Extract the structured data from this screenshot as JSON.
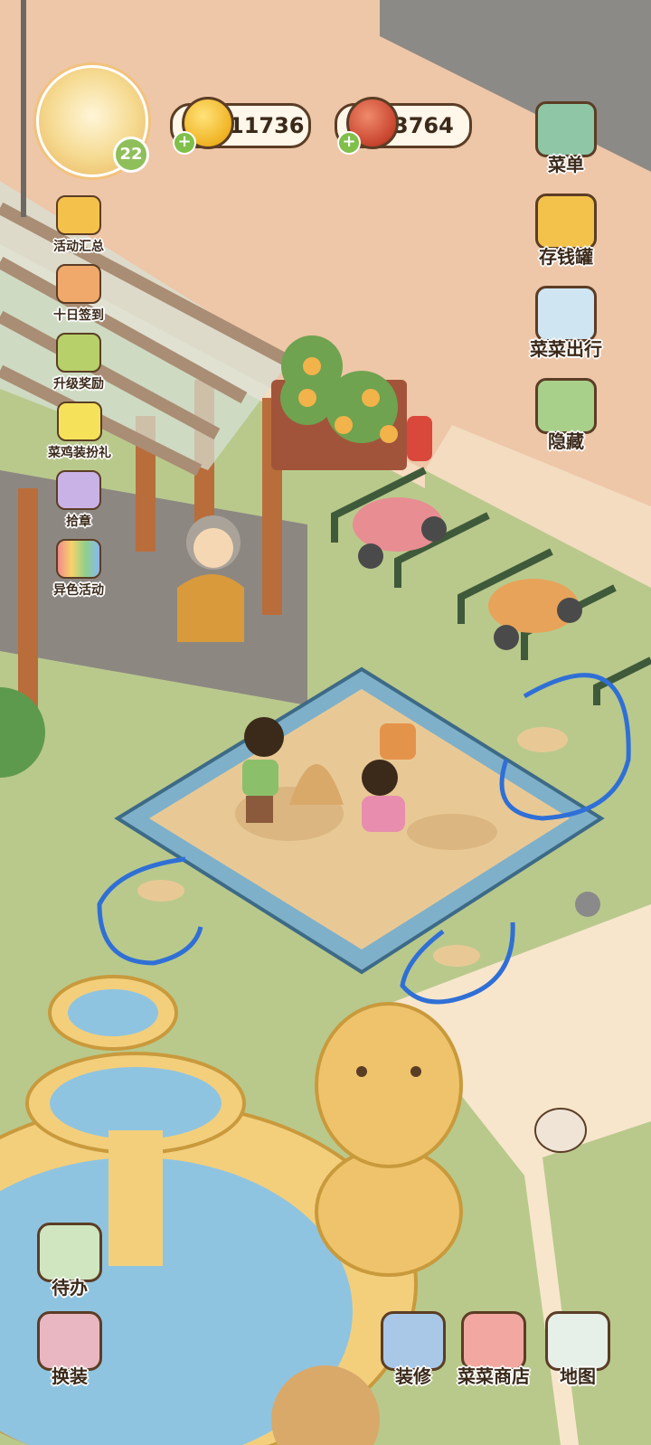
{
  "player": {
    "level": "22"
  },
  "currencies": [
    {
      "name": "coin-icon",
      "amount": "11736"
    },
    {
      "name": "meat-icon",
      "amount": "3764"
    }
  ],
  "left_menu": [
    {
      "label": "活动汇总",
      "icon": "event-summary-icon"
    },
    {
      "label": "十日签到",
      "icon": "checkin-icon"
    },
    {
      "label": "升级奖励",
      "icon": "upgrade-reward-icon"
    },
    {
      "label": "菜鸡装扮礼",
      "icon": "chick-costume-icon"
    },
    {
      "label": "拾章",
      "icon": "badge-icon"
    },
    {
      "label": "异色活动",
      "icon": "rainbow-event-icon"
    }
  ],
  "right_menu": [
    {
      "label": "菜单",
      "icon": "menu-icon"
    },
    {
      "label": "存钱罐",
      "icon": "piggy-bank-icon"
    },
    {
      "label": "菜菜出行",
      "icon": "travel-icon"
    },
    {
      "label": "隐藏",
      "icon": "hide-icon"
    }
  ],
  "bottom_left": [
    {
      "label": "待办",
      "icon": "todo-icon"
    },
    {
      "label": "换装",
      "icon": "dress-up-icon"
    }
  ],
  "bottom_right": [
    {
      "label": "装修",
      "icon": "decorate-icon"
    },
    {
      "label": "菜菜商店",
      "icon": "shop-icon"
    },
    {
      "label": "地图",
      "icon": "map-icon"
    }
  ],
  "colors": {
    "grass": "#b9c98c",
    "pavement": "#eec6a8",
    "sand": "#e8c996",
    "highlight_circle": "#2f6fd6"
  }
}
